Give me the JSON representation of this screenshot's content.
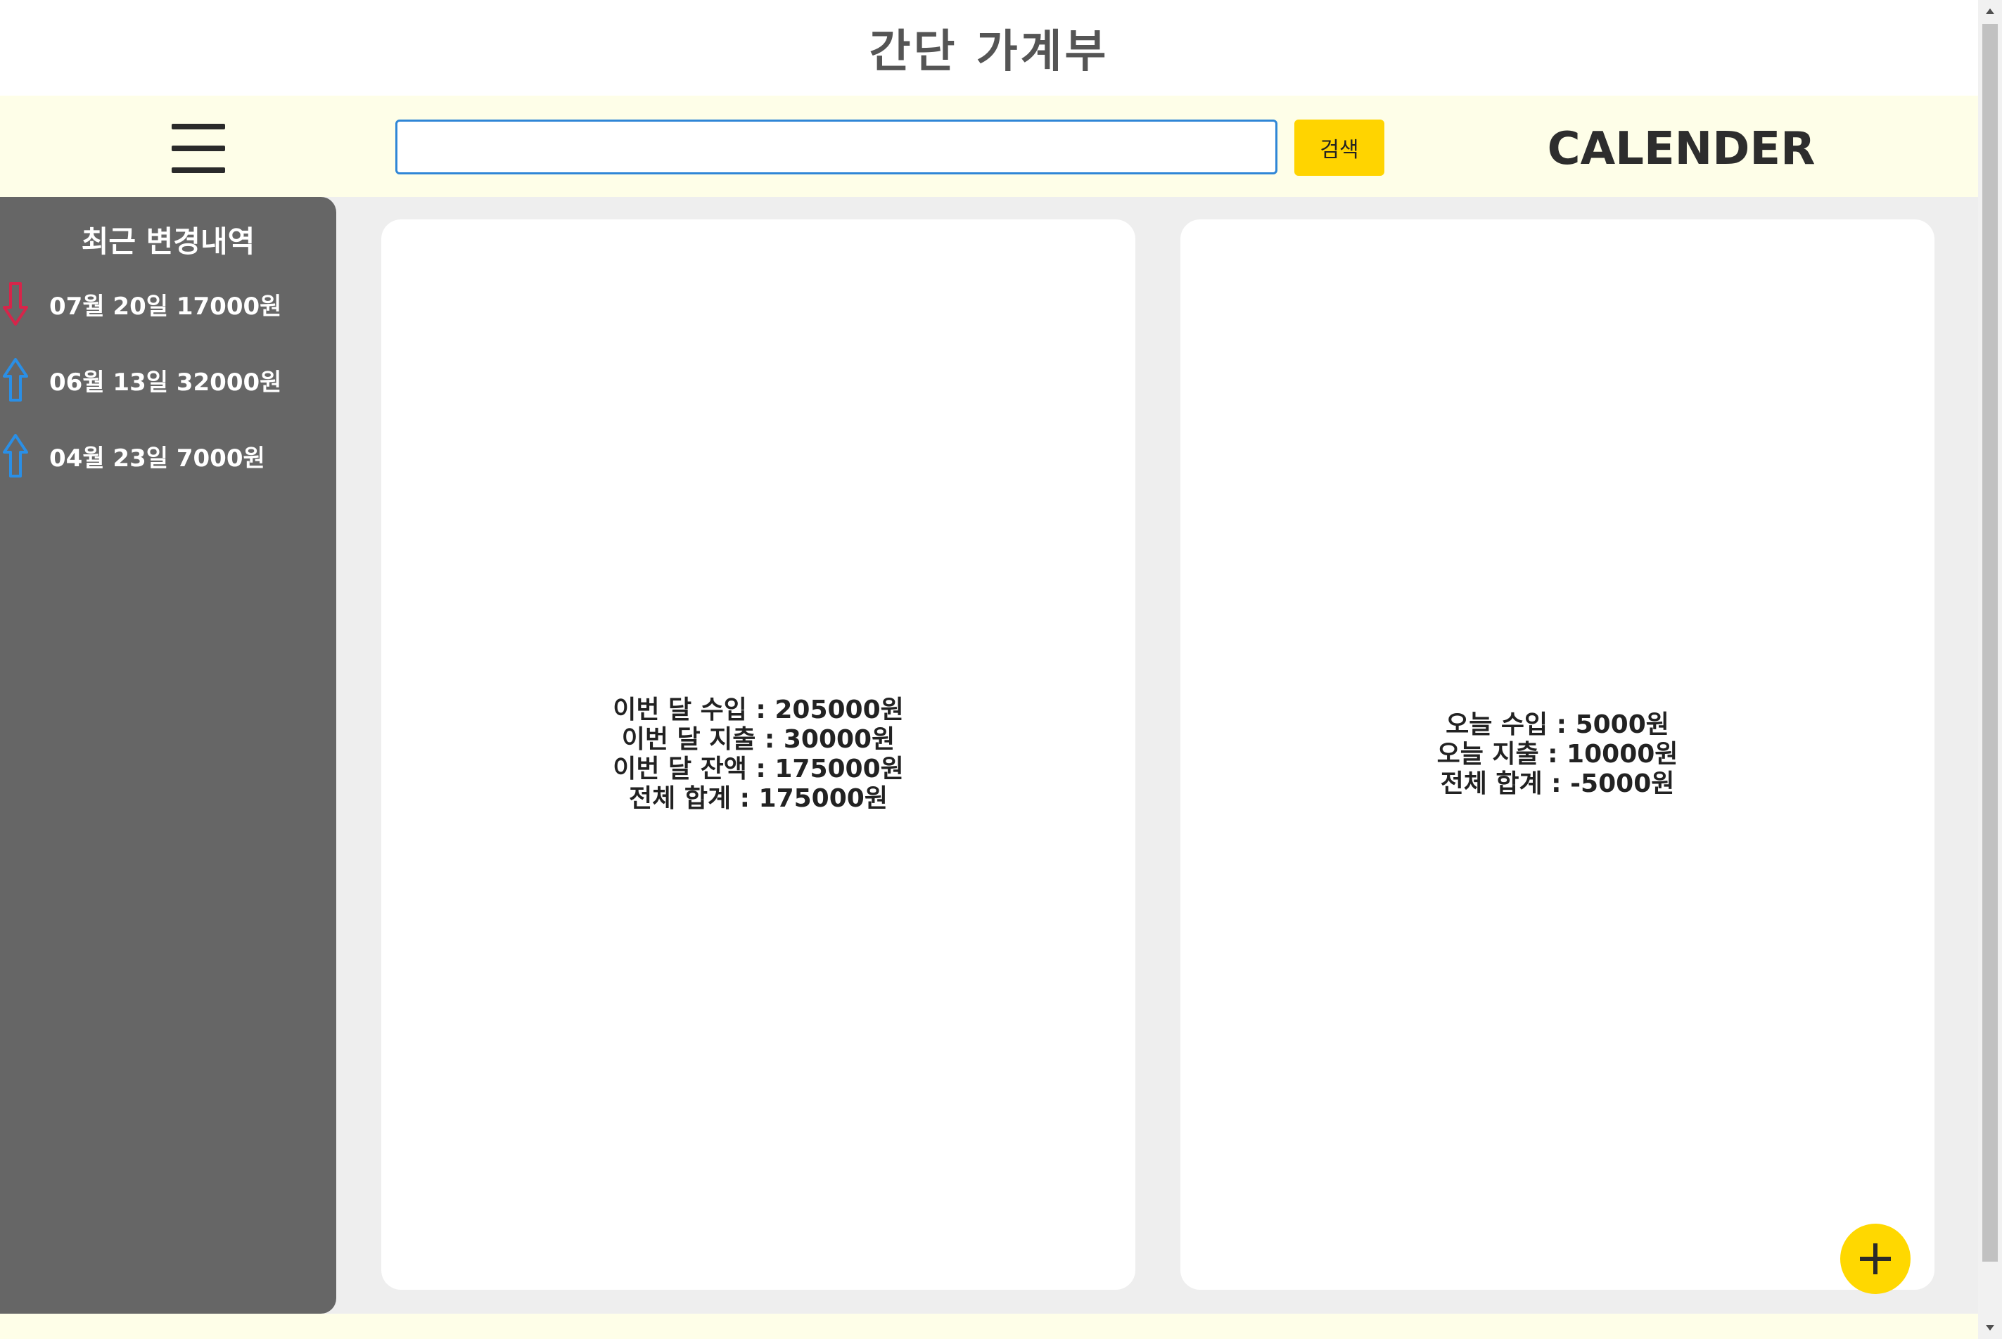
{
  "header": {
    "title": "간단 가계부"
  },
  "toolbar": {
    "menu_icon": "hamburger-icon",
    "search": {
      "value": "",
      "placeholder": ""
    },
    "search_label": "검색",
    "calendar_label": "CALENDER"
  },
  "sidebar": {
    "title": "최근 변경내역",
    "items": [
      {
        "text": "07월 20일 17000원",
        "icon": "arrow-down-icon",
        "color": "#d6254a"
      },
      {
        "text": "06월 13일 32000원",
        "icon": "arrow-up-icon",
        "color": "#2a8fe6"
      },
      {
        "text": "04월 23일 7000원",
        "icon": "arrow-up-icon",
        "color": "#2a8fe6"
      }
    ]
  },
  "monthly_summary": {
    "lines": [
      "이번 달 수입 : 205000원",
      "이번 달 지출 : 30000원",
      "이번 달 잔액 : 175000원",
      "전체 합계 : 175000원"
    ]
  },
  "daily_summary": {
    "lines": [
      "오늘 수입 : 5000원",
      "오늘 지출 : 10000원",
      "전체 합계 : -5000원"
    ]
  },
  "fab": {
    "icon": "plus-icon",
    "color": "#ffd800"
  },
  "colors": {
    "toolbar_bg": "#fefee8",
    "sidebar_bg": "#666666",
    "content_bg": "#eeeeee",
    "accent_yellow": "#ffd400",
    "search_border": "#2f86d6"
  }
}
